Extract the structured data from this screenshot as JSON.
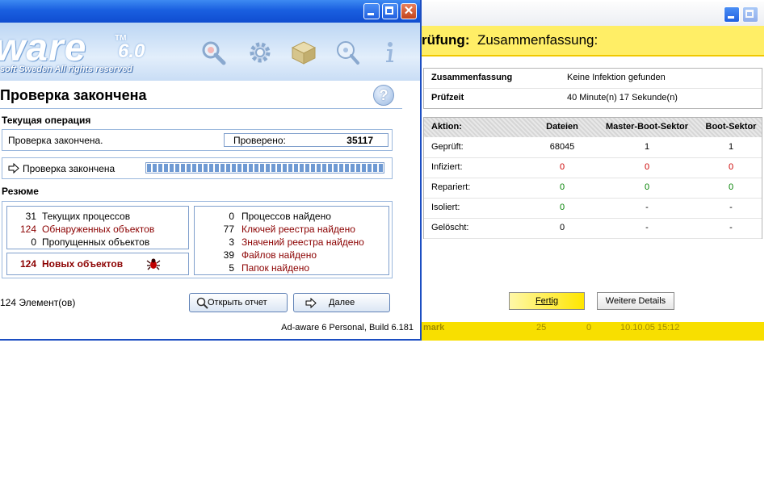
{
  "adaware": {
    "logo_text": "ware",
    "logo_tm": "TM",
    "logo_version": "6.0",
    "copyright": "soft Sweden All rights reserved",
    "toolbar_icons": [
      "magnifier-icon",
      "gear-icon",
      "box-icon",
      "search-disc-icon",
      "info-icon"
    ],
    "panel_title": "Проверка закончена",
    "help_glyph": "?",
    "current_op_label": "Текущая операция",
    "current_op_status": "Проверка закончена.",
    "checked_label": "Проверено:",
    "checked_value": "35117",
    "progress_label": "Проверка закончена",
    "progress_fraction": 1.0,
    "summary_label": "Резюме",
    "left_stats": [
      {
        "value": "31",
        "label": "Текущих процессов"
      },
      {
        "value": "124",
        "label": "Обнаруженных объектов"
      },
      {
        "value": "0",
        "label": "Пропущенных объектов"
      }
    ],
    "new_objects": {
      "value": "124",
      "label": "Новых объектов"
    },
    "right_stats": [
      {
        "value": "0",
        "label": "Процессов найдено"
      },
      {
        "value": "77",
        "label": "Ключей реестра найдено"
      },
      {
        "value": "3",
        "label": "Значений реестра найдено"
      },
      {
        "value": "39",
        "label": "Файлов найдено"
      },
      {
        "value": "5",
        "label": "Папок найдено"
      }
    ],
    "elements_count": "124 Элемент(ов)",
    "open_report_button": "Открыть отчет",
    "next_button": "Далее",
    "build_info": "Ad-aware 6 Personal, Build 6.181"
  },
  "summary_window": {
    "heading_bold": "rüfung:",
    "heading": "Zusammenfassung:",
    "info_rows": [
      {
        "label": "Zusammenfassung",
        "value": "Keine Infektion gefunden"
      },
      {
        "label": "Prüfzeit",
        "value": "40 Minute(n) 17 Sekunde(n)"
      }
    ],
    "action_headers": [
      "Aktion:",
      "Dateien",
      "Master-Boot-Sektor",
      "Boot-Sektor"
    ],
    "action_rows": [
      {
        "label": "Geprüft:",
        "values": [
          "68045",
          "1",
          "1"
        ],
        "color": "#000000"
      },
      {
        "label": "Infiziert:",
        "values": [
          "0",
          "0",
          "0"
        ],
        "color": "#cc0000"
      },
      {
        "label": "Repariert:",
        "values": [
          "0",
          "0",
          "0"
        ],
        "color": "#008000"
      },
      {
        "label": "Isoliert:",
        "values": [
          "0",
          "-",
          "-"
        ],
        "color": "#008000"
      },
      {
        "label": "Gelöscht:",
        "values": [
          "0",
          "-",
          "-"
        ],
        "color": "#000000"
      }
    ],
    "done_button": "Fertig",
    "details_button": "Weitere Details",
    "task_strip": [
      "mark",
      "25",
      "0",
      "10.10.05 15:12"
    ]
  },
  "colors": {
    "xp_blue": "#1a5fe0",
    "yellow_head": "#ffee66",
    "dark_red": "#8b0000"
  }
}
